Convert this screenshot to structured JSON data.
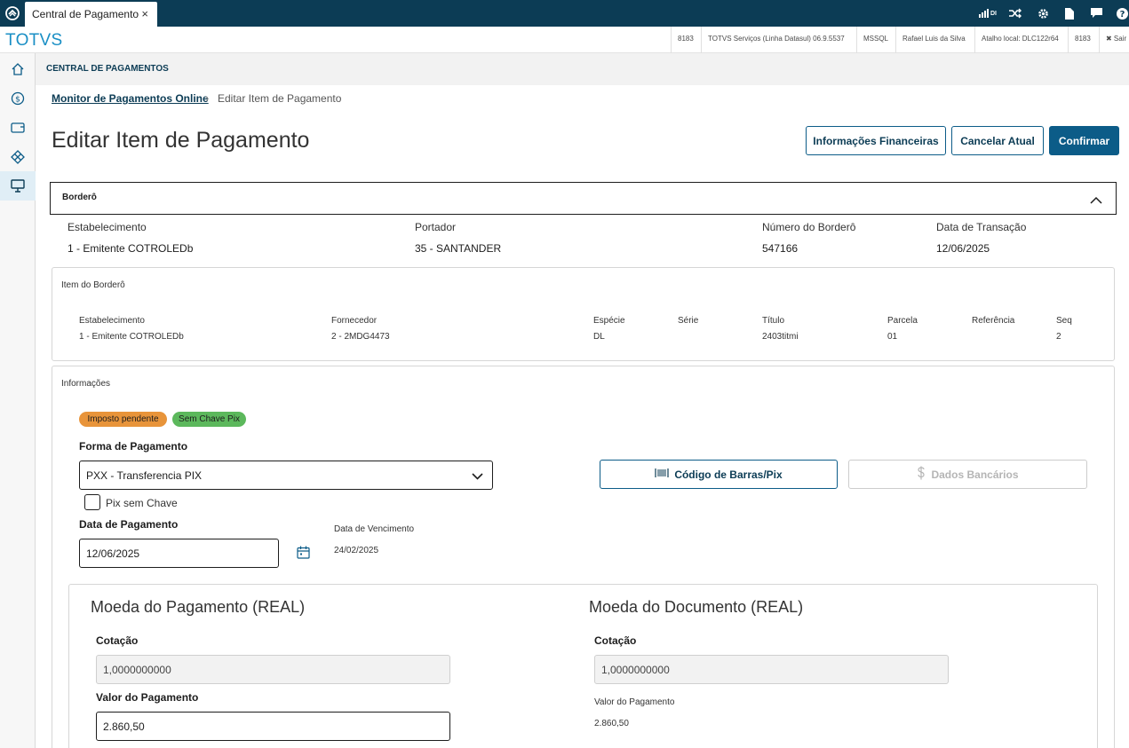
{
  "topbar": {
    "tab_label": "Central de Pagamento",
    "close_glyph": "×",
    "icons": [
      "signal-di-icon",
      "shuffle-icon",
      "gear-icon",
      "document-icon",
      "chat-icon",
      "help-icon"
    ],
    "signal_suffix": "DI"
  },
  "brandbar": {
    "brand": "TOTVS",
    "items": [
      "8183",
      "TOTVS Serviços (Linha Datasul) 06.9.5537",
      "MSSQL",
      "Rafael Luis da Silva",
      "Atalho local: DLC122r64",
      "8183"
    ],
    "exit_label": "✖ Sair"
  },
  "sidebar": {
    "items": [
      "home-icon",
      "payment-icon",
      "wallet-icon",
      "workflow-icon",
      "monitor-icon"
    ]
  },
  "page": {
    "header": "CENTRAL DE PAGAMENTOS",
    "breadcrumb": [
      "Monitor de Pagamentos Online",
      "Editar Item de Pagamento"
    ],
    "breadcrumb_sep": "›",
    "title": "Editar Item de Pagamento",
    "buttons": {
      "financial": "Informações Financeiras",
      "cancel": "Cancelar Atual",
      "confirm": "Confirmar"
    }
  },
  "bordero": {
    "title": "Borderô",
    "fields": [
      {
        "label": "Estabelecimento",
        "value": "1 - Emitente COTROLEDb"
      },
      {
        "label": "Portador",
        "value": "35 - SANTANDER"
      },
      {
        "label": "Número do Borderô",
        "value": "547166"
      },
      {
        "label": "Data de Transação",
        "value": "12/06/2025"
      }
    ]
  },
  "item": {
    "title": "Item do Borderô",
    "columns": [
      {
        "label": "Estabelecimento",
        "value": "1 - Emitente COTROLEDb"
      },
      {
        "label": "Fornecedor",
        "value": "2 - 2MDG4473"
      },
      {
        "label": "Espécie",
        "value": "DL"
      },
      {
        "label": "Série",
        "value": ""
      },
      {
        "label": "Título",
        "value": "2403titmi"
      },
      {
        "label": "Parcela",
        "value": "01"
      },
      {
        "label": "Referência",
        "value": ""
      },
      {
        "label": "Seq",
        "value": "2"
      }
    ]
  },
  "info": {
    "title": "Informações",
    "tags": [
      {
        "label": "Imposto pendente",
        "color": "#e8943a"
      },
      {
        "label": "Sem Chave Pix",
        "color": "#5cb85c"
      }
    ],
    "payment_form_label": "Forma de Pagamento",
    "payment_form_value": "PXX - Transferencia PIX",
    "pix_checkbox_label": "Pix sem Chave",
    "barcode_button": "Código de Barras/Pix",
    "bank_button": "Dados Bancários",
    "payment_date_label": "Data de Pagamento",
    "payment_date_value": "12/06/2025",
    "due_date_label": "Data de Vencimento",
    "due_date_value": "24/02/2025"
  },
  "currency": {
    "payment": {
      "title": "Moeda do Pagamento (REAL)",
      "rate_label": "Cotação",
      "rate_value": "1,0000000000",
      "amount_label": "Valor do Pagamento",
      "amount_value": "2.860,50"
    },
    "document": {
      "title": "Moeda do Documento (REAL)",
      "rate_label": "Cotação",
      "rate_value": "1,0000000000",
      "amount_label": "Valor do Pagamento",
      "amount_value": "2.860,50"
    }
  },
  "colors": {
    "primary": "#0c5c88",
    "dark": "#0c3c55",
    "brand": "#1a8fc5"
  }
}
